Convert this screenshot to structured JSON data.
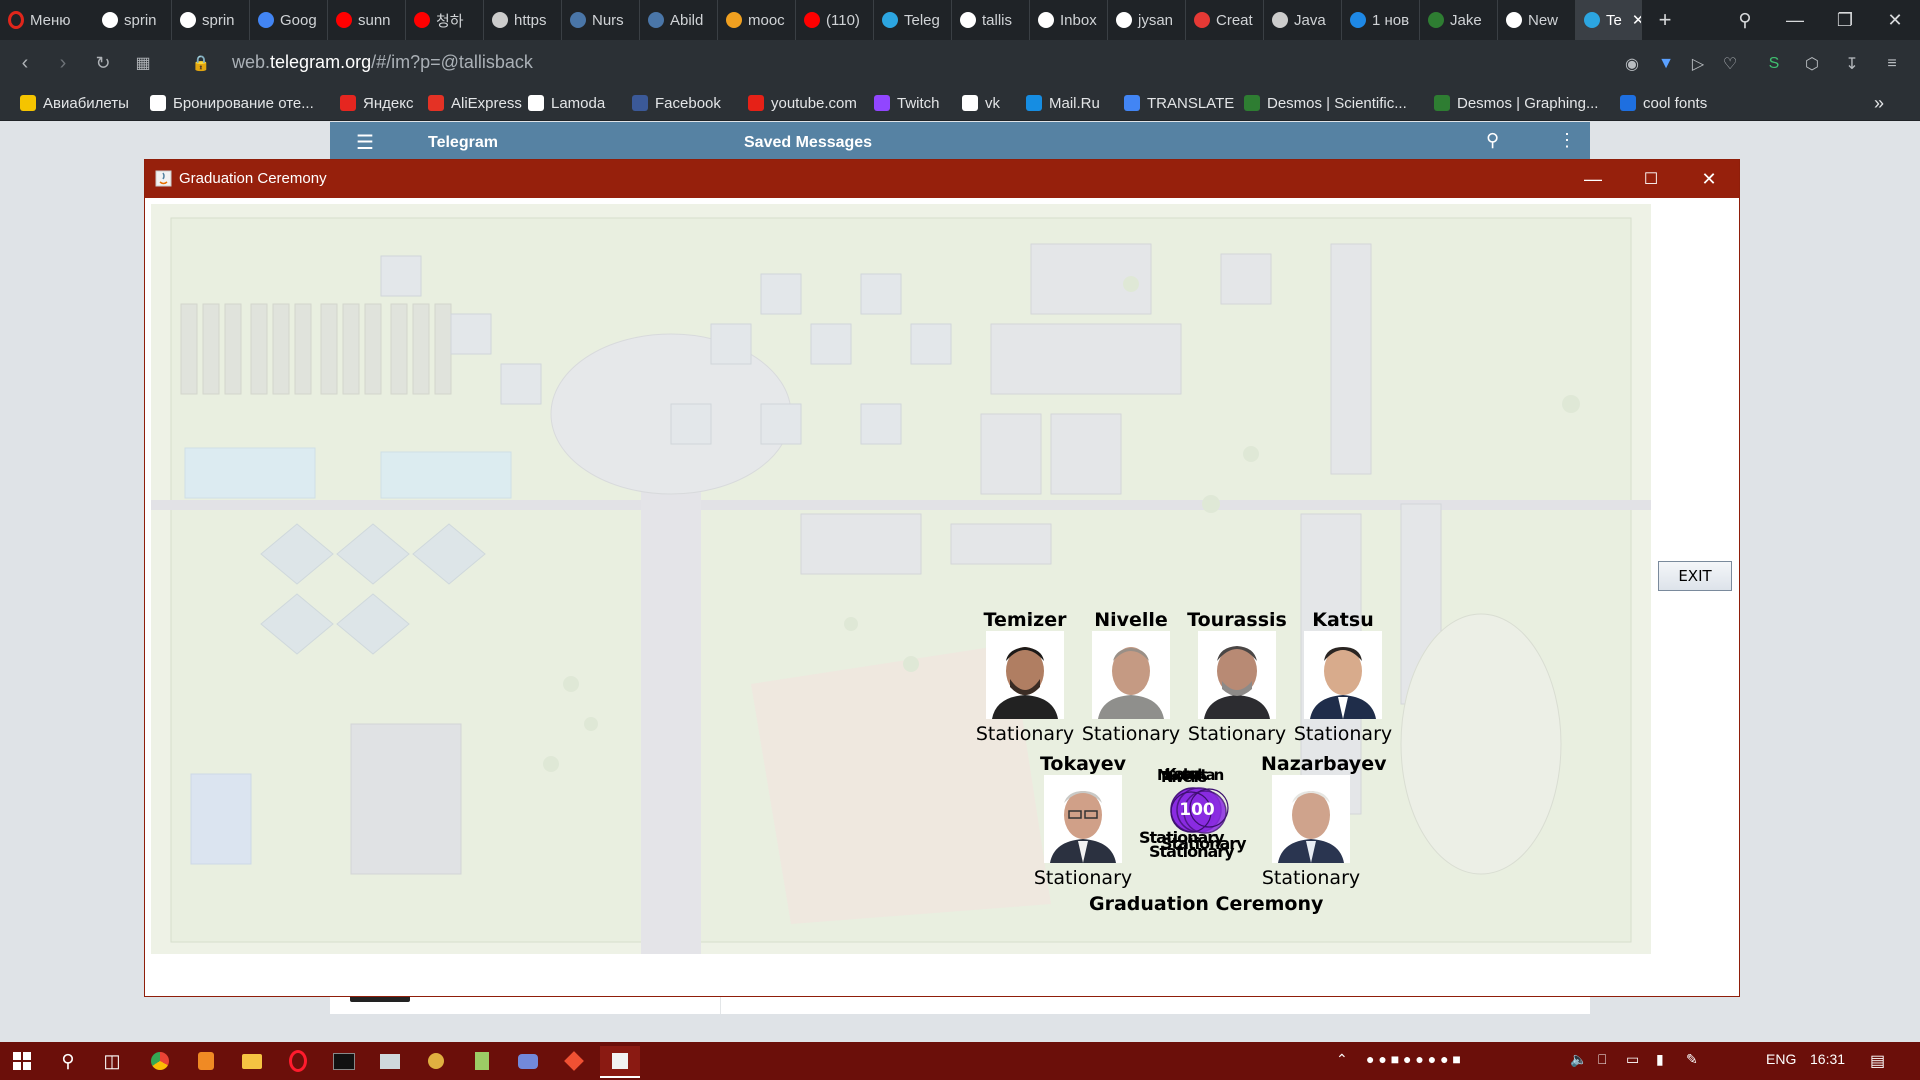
{
  "browser": {
    "menu_label": "Меню",
    "tabs": [
      {
        "label": "sprin",
        "icon": "github-icon"
      },
      {
        "label": "sprin",
        "icon": "github-icon"
      },
      {
        "label": "Goog",
        "icon": "google-translate-icon"
      },
      {
        "label": "sunn",
        "icon": "youtube-icon"
      },
      {
        "label": "청하",
        "icon": "youtube-icon"
      },
      {
        "label": "https",
        "icon": "link-icon"
      },
      {
        "label": "Nurs",
        "icon": "vk-icon"
      },
      {
        "label": "Abild",
        "icon": "vk-icon"
      },
      {
        "label": "mooc",
        "icon": "mooc-icon"
      },
      {
        "label": "(110)",
        "icon": "youtube-icon"
      },
      {
        "label": "Teleg",
        "icon": "telegram-icon"
      },
      {
        "label": "tallis",
        "icon": "github-icon"
      },
      {
        "label": "Inbox",
        "icon": "gmail-icon"
      },
      {
        "label": "jysan",
        "icon": "google-icon"
      },
      {
        "label": "Creat",
        "icon": "create-icon"
      },
      {
        "label": "Java",
        "icon": "java-icon"
      },
      {
        "label": "1 нов",
        "icon": "number-icon"
      },
      {
        "label": "Jake",
        "icon": "jake-icon"
      },
      {
        "label": "New",
        "icon": "github-icon"
      },
      {
        "label": "Te",
        "icon": "telegram-icon"
      }
    ],
    "url_prefix": "web.",
    "url_domain": "telegram.org",
    "url_path": "/#/im?p=@tallisback",
    "bookmarks": [
      {
        "label": "Авиабилеты",
        "color": "#f5c400"
      },
      {
        "label": "Бронирование оте...",
        "color": "#ffffff"
      },
      {
        "label": "Яндекс",
        "color": "#e52620"
      },
      {
        "label": "AliExpress",
        "color": "#e43225"
      },
      {
        "label": "Lamoda",
        "color": "#ffffff"
      },
      {
        "label": "Facebook",
        "color": "#3b5998"
      },
      {
        "label": "youtube.com",
        "color": "#e62117"
      },
      {
        "label": "Twitch",
        "color": "#9146ff"
      },
      {
        "label": "vk",
        "color": "#ffffff"
      },
      {
        "label": "Mail.Ru",
        "color": "#168de2"
      },
      {
        "label": "TRANSLATE",
        "color": "#4285f4"
      },
      {
        "label": "Desmos | Scientific...",
        "color": "#2e7d32"
      },
      {
        "label": "Desmos | Graphing...",
        "color": "#2e7d32"
      },
      {
        "label": "cool fonts",
        "color": "#1e6fe0"
      }
    ]
  },
  "telegram": {
    "app_name": "Telegram",
    "chat_title": "Saved Messages"
  },
  "app_window": {
    "title": "Graduation Ceremony",
    "exit_label": "EXIT",
    "caption": "Graduation Ceremony",
    "cluster_value": "100",
    "cluster_status": "Stationary"
  },
  "people": [
    {
      "name": "Temizer",
      "status": "Stationary"
    },
    {
      "name": "Nivelle",
      "status": "Stationary"
    },
    {
      "name": "Tourassis",
      "status": "Stationary"
    },
    {
      "name": "Katsu",
      "status": "Stationary"
    },
    {
      "name": "Tokayev",
      "status": "Stationary"
    },
    {
      "name": "Nazarbayev",
      "status": "Stationary"
    }
  ],
  "taskbar": {
    "lang": "ENG",
    "time": "16:31"
  },
  "colors": {
    "java_titlebar": "#96200c",
    "taskbar": "#6b0f0a",
    "cluster_purple": "#8a2be2"
  }
}
